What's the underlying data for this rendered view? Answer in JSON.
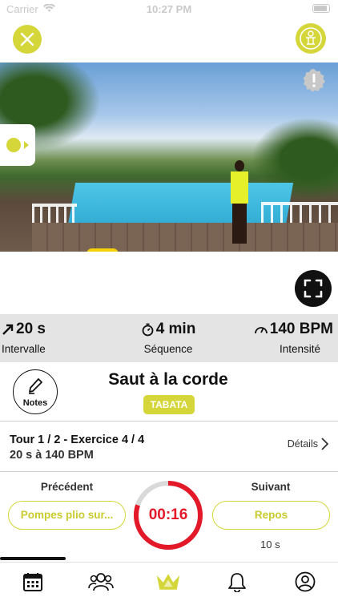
{
  "status_bar": {
    "carrier": "Carrier",
    "time": "10:27 PM"
  },
  "stats": {
    "interval": {
      "value": "20 s",
      "label": "Intervalle"
    },
    "sequence": {
      "value": "4 min",
      "label": "Séquence"
    },
    "intensity": {
      "value": "140 BPM",
      "label": "Intensité"
    }
  },
  "exercise": {
    "notes_label": "Notes",
    "title": "Saut à la corde",
    "tag": "TABATA"
  },
  "tour": {
    "line1": "Tour 1 / 2 - Exercice 4 / 4",
    "line2": "20 s à 140 BPM",
    "details_label": "Détails"
  },
  "navigation": {
    "previous_label": "Précédent",
    "previous_button": "Pompes plio sur...",
    "next_label": "Suivant",
    "next_button": "Repos",
    "next_duration": "10 s",
    "timer": "00:16",
    "timer_progress": 0.8
  },
  "icons": {
    "close": "close-icon",
    "coach": "coach-icon",
    "warning": "warning-icon",
    "fullscreen": "fullscreen-icon",
    "interval": "arrow-up-right-icon",
    "sequence": "stopwatch-icon",
    "intensity": "speedometer-icon",
    "pencil": "pencil-icon",
    "tabs": [
      "calendar-icon",
      "group-icon",
      "crown-icon",
      "bell-icon",
      "profile-icon"
    ]
  },
  "colors": {
    "accent": "#d4d63a",
    "timer_red": "#e3192a",
    "stats_bg": "#e4e4e4",
    "text": "#111111"
  }
}
